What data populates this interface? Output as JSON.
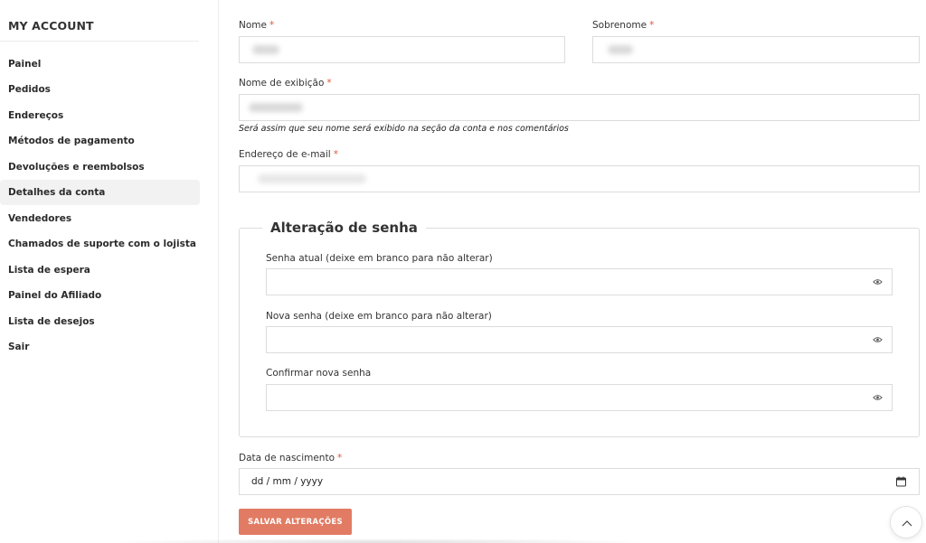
{
  "sidebar": {
    "title": "MY ACCOUNT",
    "items": [
      {
        "label": "Painel"
      },
      {
        "label": "Pedidos"
      },
      {
        "label": "Endereços"
      },
      {
        "label": "Métodos de pagamento"
      },
      {
        "label": "Devoluções e reembolsos"
      },
      {
        "label": "Detalhes da conta"
      },
      {
        "label": "Vendedores"
      },
      {
        "label": "Chamados de suporte com o lojista"
      },
      {
        "label": "Lista de espera"
      },
      {
        "label": "Painel do Afiliado"
      },
      {
        "label": "Lista de desejos"
      },
      {
        "label": "Sair"
      }
    ],
    "active_item": "Detalhes da conta"
  },
  "form": {
    "first_name_label": "Nome",
    "last_name_label": "Sobrenome",
    "display_name_label": "Nome de exibição",
    "display_name_hint": "Será assim que seu nome será exibido na seção da conta e nos comentários",
    "email_label": "Endereço de e-mail",
    "required_mark": "*",
    "password_section": {
      "legend": "Alteração de senha",
      "current_label": "Senha atual (deixe em branco para não alterar)",
      "new_label": "Nova senha (deixe em branco para não alterar)",
      "confirm_label": "Confirmar nova senha"
    },
    "birthdate_label": "Data de nascimento",
    "birthdate_value": "dd / mm / yyyy",
    "save_label": "SALVAR ALTERAÇÕES"
  },
  "colors": {
    "accent": "#e27b63",
    "required": "#e0553b",
    "active_bg": "#f2f2f2"
  },
  "icons": [
    "eye-icon",
    "calendar-icon",
    "chevron-up-icon"
  ]
}
